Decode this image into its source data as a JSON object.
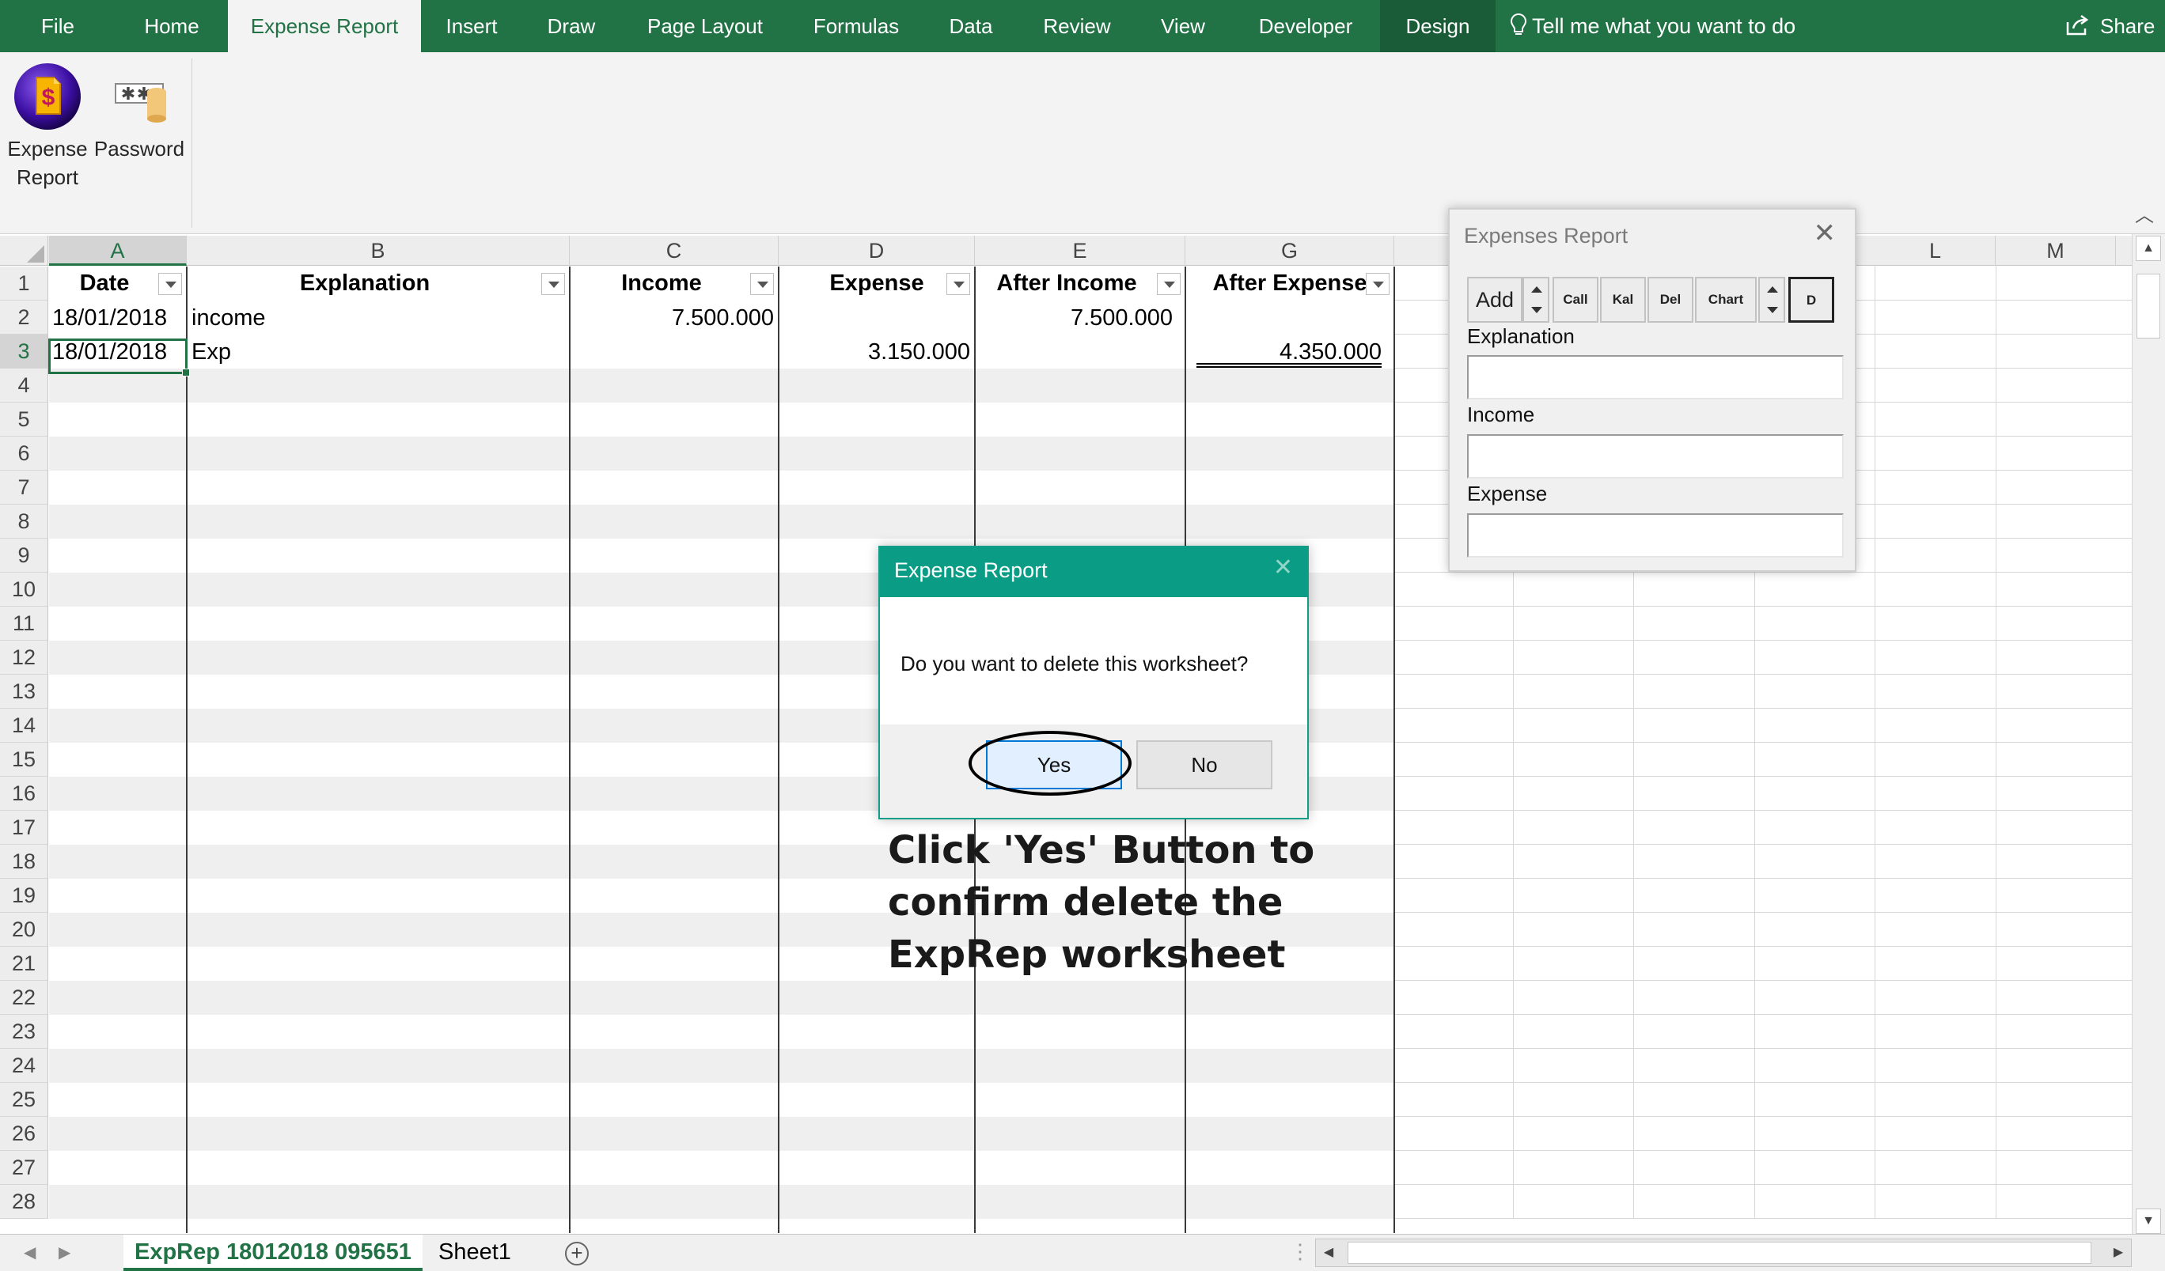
{
  "ribbon": {
    "tabs": [
      "File",
      "Home",
      "Expense Report",
      "Insert",
      "Draw",
      "Page Layout",
      "Formulas",
      "Data",
      "Review",
      "View",
      "Developer",
      "Design"
    ],
    "active_tab": "Expense Report",
    "tell_me": "Tell me what you want to do",
    "share": "Share",
    "buttons": [
      {
        "line1": "Expense",
        "line2": "Report",
        "icon": "dollar-document-icon"
      },
      {
        "line1": "Password",
        "line2": "",
        "icon": "password-key-icon"
      }
    ]
  },
  "grid": {
    "columns": [
      "A",
      "B",
      "C",
      "D",
      "E",
      "G",
      "",
      "L",
      "M"
    ],
    "selected_column": "A",
    "headers": [
      "Date",
      "Explanation",
      "Income",
      "Expense",
      "After Income",
      "After Expense"
    ],
    "rows": [
      {
        "date": "18/01/2018",
        "explanation": "income",
        "income": "7.500.000",
        "expense": "",
        "after_income": "7.500.000",
        "after_expense": ""
      },
      {
        "date": "18/01/2018",
        "explanation": "Exp",
        "income": "",
        "expense": "3.150.000",
        "after_income": "",
        "after_expense": "4.350.000"
      }
    ],
    "row_numbers": [
      "1",
      "2",
      "3",
      "4",
      "5",
      "6",
      "7",
      "8",
      "9",
      "10",
      "11",
      "12",
      "13",
      "14",
      "15",
      "16",
      "17",
      "18",
      "19",
      "20",
      "21",
      "22",
      "23",
      "24",
      "25",
      "26",
      "27",
      "28"
    ],
    "selected_row": "3"
  },
  "sheets": {
    "tabs": [
      "ExpRep 18012018 095651",
      "Sheet1"
    ],
    "active": "ExpRep 18012018 095651",
    "add_icon": "plus-circle-icon"
  },
  "userform": {
    "title": "Expenses Report",
    "buttons": [
      "Add",
      "Call",
      "Kal",
      "Del",
      "Chart",
      "D"
    ],
    "fields": [
      {
        "label": "Explanation",
        "value": ""
      },
      {
        "label": "Income",
        "value": ""
      },
      {
        "label": "Expense",
        "value": ""
      }
    ]
  },
  "dialog": {
    "title": "Expense Report",
    "message": "Do you want to delete this worksheet?",
    "yes": "Yes",
    "no": "No"
  },
  "instruction": {
    "line1": "Click 'Yes' Button to",
    "line2": "confirm delete the",
    "line3": "ExpRep worksheet"
  },
  "colors": {
    "ribbon_green": "#217346",
    "dialog_teal": "#0a9c84"
  }
}
